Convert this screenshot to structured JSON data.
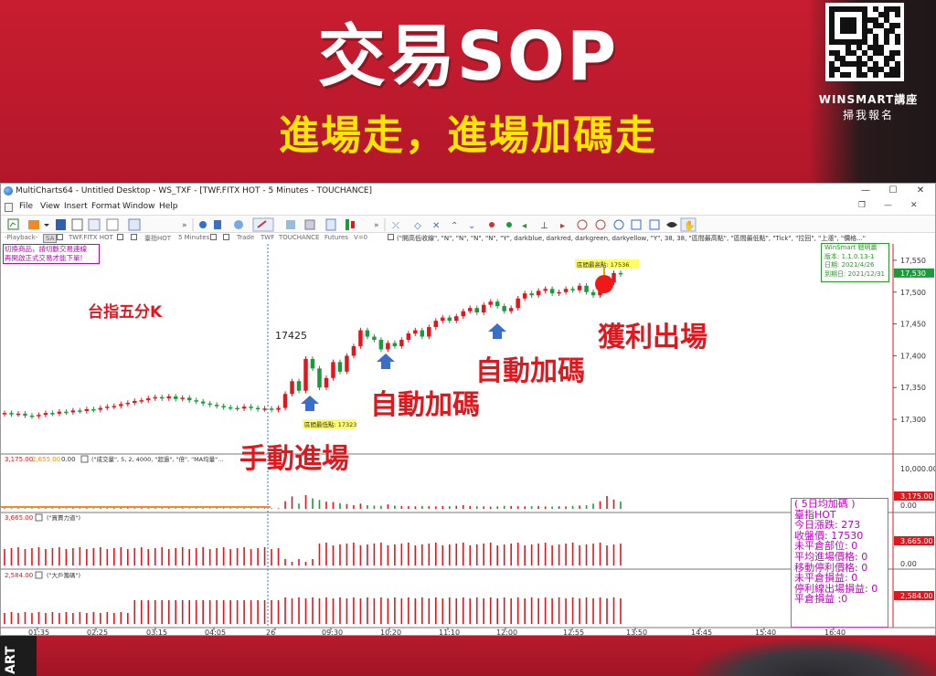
{
  "banner": {
    "title": "交易SOP",
    "subtitle": "進場走，進場加碼走",
    "brand_name": "WINSMART講座",
    "brand_cta": "掃我報名"
  },
  "bottom": {
    "vertical_text": "ART"
  },
  "window": {
    "title": "MultiCharts64 - Untitled Desktop - WS_TXF - [TWF.FITX HOT - 5 Minutes - TOUCHANCE]",
    "controls": {
      "minimize": "—",
      "maximize": "☐",
      "close": "✕"
    }
  },
  "menu": {
    "items": [
      "File",
      "View",
      "Insert",
      "Format",
      "Window",
      "Help"
    ]
  },
  "symbol_bar": {
    "playback": "-Playback-",
    "sa": "SA",
    "symbol": "TWF.FITX HOT",
    "instrument": "臺指HOT",
    "interval": "5 Minutes",
    "trade": "Trade",
    "exchange": "TWF",
    "source": "TOUCHANCE",
    "type": "Futures",
    "volume": "V=0",
    "indicator": "(\"開高低收線\", \"N\", \"N\", \"N\", \"N\", \"Y\", darkblue, darkred, darkgreen, darkyellow, \"Y\", 38, 38, \"區間最高點\", \"區間最低點\", \"Tick\", \"拉回\", \"上漲\", \"價格...\""
  },
  "warning_box": [
    "切換商品，請切斷交易連線",
    "再開啟正式交易才能下單!"
  ],
  "info_box": {
    "title": "WinSmart 聰明贏",
    "version": "版本: 1.1.0.13-1",
    "date": "日期: 2021/4/26",
    "expiry": "到期日: 2021/12/31"
  },
  "stat_box": {
    "header": "( 5日均加碼 )",
    "instrument": "臺指HOT",
    "change": "今日漲跌: 273",
    "close": "收盤價: 17530",
    "open_position": "未平倉部位: 0",
    "avg_entry": "平均進場價格: 0",
    "trailing_stop": "移動停利價格: 0",
    "unrealized": "未平倉損益: 0",
    "stop_exit": "停利線出場損益: 0",
    "closed_pnl": "平倉損益 :0"
  },
  "annotations": {
    "chart_label": "台指五分K",
    "manual_entry": "手動進場",
    "auto_add_1": "自動加碼",
    "auto_add_2": "自動加碼",
    "take_profit": "獲利出場",
    "price_17425": "17425",
    "range_low": "區間最低點: 17323",
    "range_high": "區間最高點: 17536"
  },
  "price_axis": {
    "labels": [
      "17,550",
      "17,500",
      "17,450",
      "17,400",
      "17,350",
      "17,300"
    ],
    "last_price": "17,530",
    "ylim": [
      17280,
      17570
    ]
  },
  "volume_pane": {
    "header_values": [
      "3,175.00",
      "2,655.00",
      "0.00"
    ],
    "indicator": "(\"成交量\", 5, 2, 4000, \"超過\", \"倍\", \"MA均量\"...",
    "axis_labels": [
      "10,000.00",
      "0.00"
    ],
    "last_value": "3,175.00"
  },
  "pane3": {
    "header_value": "3,665.00",
    "indicator": "(\"買賣力道\")",
    "axis_labels": [
      "0.00"
    ],
    "last_value": "3,665.00"
  },
  "pane4": {
    "header_value": "2,584.00",
    "indicator": "(\"大戶籌碼\")",
    "last_value": "2,584.00"
  },
  "time_axis": {
    "labels": [
      "01:35",
      "02:25",
      "03:15",
      "04:05",
      "26",
      "09:30",
      "10:20",
      "11:10",
      "12:00",
      "12:55",
      "13:50",
      "14:45",
      "15:40",
      "16:40"
    ]
  },
  "colors": {
    "banner_red": "#c81d30",
    "banner_yellow": "#ffe600",
    "candle_up": "#e0181e",
    "candle_down": "#1a9a3a",
    "annotation_red": "#e0181e",
    "info_green": "#2a9a2a",
    "stat_magenta": "#c000c0",
    "arrow_blue": "#3a6fc9"
  },
  "chart_data": {
    "type": "candlestick",
    "title": "台指五分K",
    "series": [
      {
        "name": "TWF.FITX HOT 5 Minutes",
        "close": [
          17310,
          17308,
          17309,
          17306,
          17305,
          17307,
          17310,
          17309,
          17312,
          17311,
          17314,
          17313,
          17316,
          17315,
          17318,
          17320,
          17321,
          17324,
          17326,
          17329,
          17330,
          17333,
          17335,
          17333,
          17336,
          17332,
          17334,
          17330,
          17328,
          17325,
          17323,
          17321,
          17319,
          17318,
          17317,
          17320,
          17318,
          17316,
          17317,
          17315,
          17318,
          17340,
          17360,
          17345,
          17395,
          17380,
          17350,
          17365,
          17390,
          17375,
          17400,
          17415,
          17440,
          17430,
          17425,
          17410,
          17420,
          17415,
          17425,
          17435,
          17440,
          17430,
          17445,
          17455,
          17460,
          17455,
          17462,
          17470,
          17475,
          17468,
          17480,
          17485,
          17478,
          17470,
          17475,
          17490,
          17498,
          17495,
          17502,
          17505,
          17498,
          17500,
          17505,
          17503,
          17510,
          17500,
          17495,
          17505,
          17515,
          17530,
          17528
        ]
      }
    ],
    "volume": [
      150,
      160,
      140,
      155,
      145,
      150,
      160,
      170,
      155,
      150,
      165,
      170,
      160,
      150,
      155,
      160,
      170,
      175,
      165,
      160,
      150,
      155,
      160,
      165,
      150,
      145,
      150,
      140,
      150,
      160,
      155,
      150,
      145,
      150,
      140,
      150,
      145,
      150,
      140,
      145,
      150,
      1900,
      3100,
      1300,
      3400,
      2600,
      2200,
      1800,
      1700,
      1400,
      1200,
      900,
      1300,
      900,
      800,
      750,
      1100,
      800,
      700,
      650,
      600,
      700,
      650,
      600,
      700,
      650,
      750,
      900,
      700,
      650,
      600,
      550,
      600,
      750,
      700,
      650,
      600,
      650,
      700,
      600,
      550,
      650,
      600,
      700,
      800,
      900,
      1300,
      1900,
      3175,
      2300,
      1800
    ],
    "ylim": [
      17280,
      17570
    ],
    "grid": false,
    "annotations": [
      "手動進場",
      "自動加碼",
      "自動加碼",
      "獲利出場"
    ]
  }
}
